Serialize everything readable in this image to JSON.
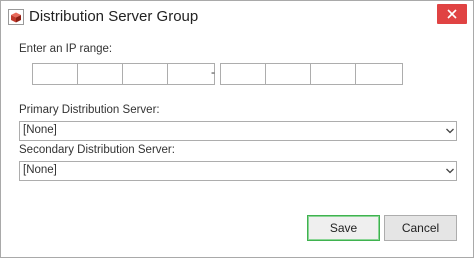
{
  "window": {
    "title": "Distribution Server Group",
    "app_icon": "red-cube-icon",
    "close_icon": "close-icon",
    "accent_close": "#e04343"
  },
  "ip_range": {
    "label": "Enter an IP range:",
    "separator": "-",
    "start_octets": [
      "",
      "",
      "",
      ""
    ],
    "end_octets": [
      "",
      "",
      "",
      ""
    ]
  },
  "primary": {
    "label": "Primary Distribution Server:",
    "value": "[None]"
  },
  "secondary": {
    "label": "Secondary Distribution Server:",
    "value": "[None]"
  },
  "buttons": {
    "save": "Save",
    "cancel": "Cancel",
    "save_border_color": "#3fb24f"
  }
}
